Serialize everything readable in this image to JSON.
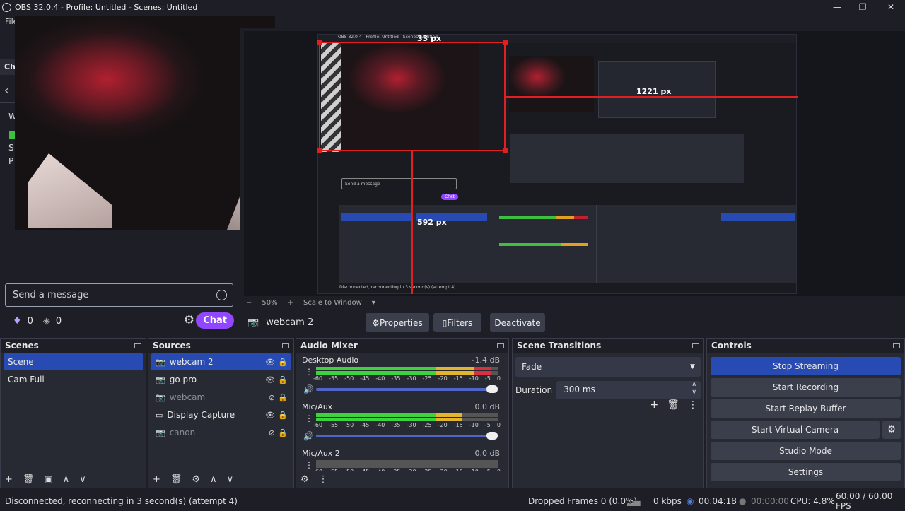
{
  "window": {
    "title": "OBS 32.0.4 - Profile: Untitled - Scenes: Untitled",
    "minimize": "—",
    "maximize": "❐",
    "close": "✕"
  },
  "menu": {
    "file": "File",
    "chat_tab": "Ch"
  },
  "chat": {
    "left_stubs": [
      "W",
      "S",
      "P"
    ],
    "placeholder": "Send a message",
    "bits_count": "0",
    "points_count": "0",
    "chat_button": "Chat"
  },
  "preview": {
    "zoom": "50%",
    "zoom_minus": "−",
    "zoom_plus": "+",
    "scale_label": "Scale to Window",
    "measure_top": "33 px",
    "measure_right": "1221 px",
    "measure_left": "592 px"
  },
  "source_toolbar": {
    "source_name": "webcam 2",
    "properties": "Properties",
    "filters": "Filters",
    "deactivate": "Deactivate"
  },
  "scenes": {
    "title": "Scenes",
    "items": [
      "Scene",
      "Cam Full"
    ]
  },
  "sources": {
    "title": "Sources",
    "items": [
      {
        "name": "webcam 2",
        "visible": true,
        "selected": true
      },
      {
        "name": "go pro",
        "visible": true,
        "selected": false
      },
      {
        "name": "webcam",
        "visible": false,
        "selected": false
      },
      {
        "name": "Display Capture",
        "visible": true,
        "selected": false
      },
      {
        "name": "canon",
        "visible": false,
        "selected": false
      }
    ]
  },
  "audio_mixer": {
    "title": "Audio Mixer",
    "ticks": [
      "-60",
      "-55",
      "-50",
      "-45",
      "-40",
      "-35",
      "-30",
      "-25",
      "-20",
      "-15",
      "-10",
      "-5",
      "0"
    ],
    "channels": [
      {
        "name": "Desktop Audio",
        "db": "-1.4 dB",
        "level": 0.96
      },
      {
        "name": "Mic/Aux",
        "db": "0.0 dB",
        "level": 0.8
      },
      {
        "name": "Mic/Aux 2",
        "db": "0.0 dB",
        "level": 0.0
      }
    ]
  },
  "transitions": {
    "title": "Scene Transitions",
    "selected": "Fade",
    "duration_label": "Duration",
    "duration_value": "300 ms"
  },
  "controls": {
    "title": "Controls",
    "stop_streaming": "Stop Streaming",
    "start_recording": "Start Recording",
    "start_replay": "Start Replay Buffer",
    "start_virtual_cam": "Start Virtual Camera",
    "studio_mode": "Studio Mode",
    "settings": "Settings"
  },
  "status": {
    "message": "Disconnected, reconnecting in 3 second(s) (attempt 4)",
    "dropped_frames": "Dropped Frames 0 (0.0%)",
    "kbps": "0 kbps",
    "stream_time": "00:04:18",
    "record_time": "00:00:00",
    "cpu": "CPU: 4.8%",
    "fps": "60.00 / 60.00 FPS"
  },
  "colors": {
    "accent": "#284bb3",
    "chat": "#9147ff",
    "measure": "#e02020"
  }
}
